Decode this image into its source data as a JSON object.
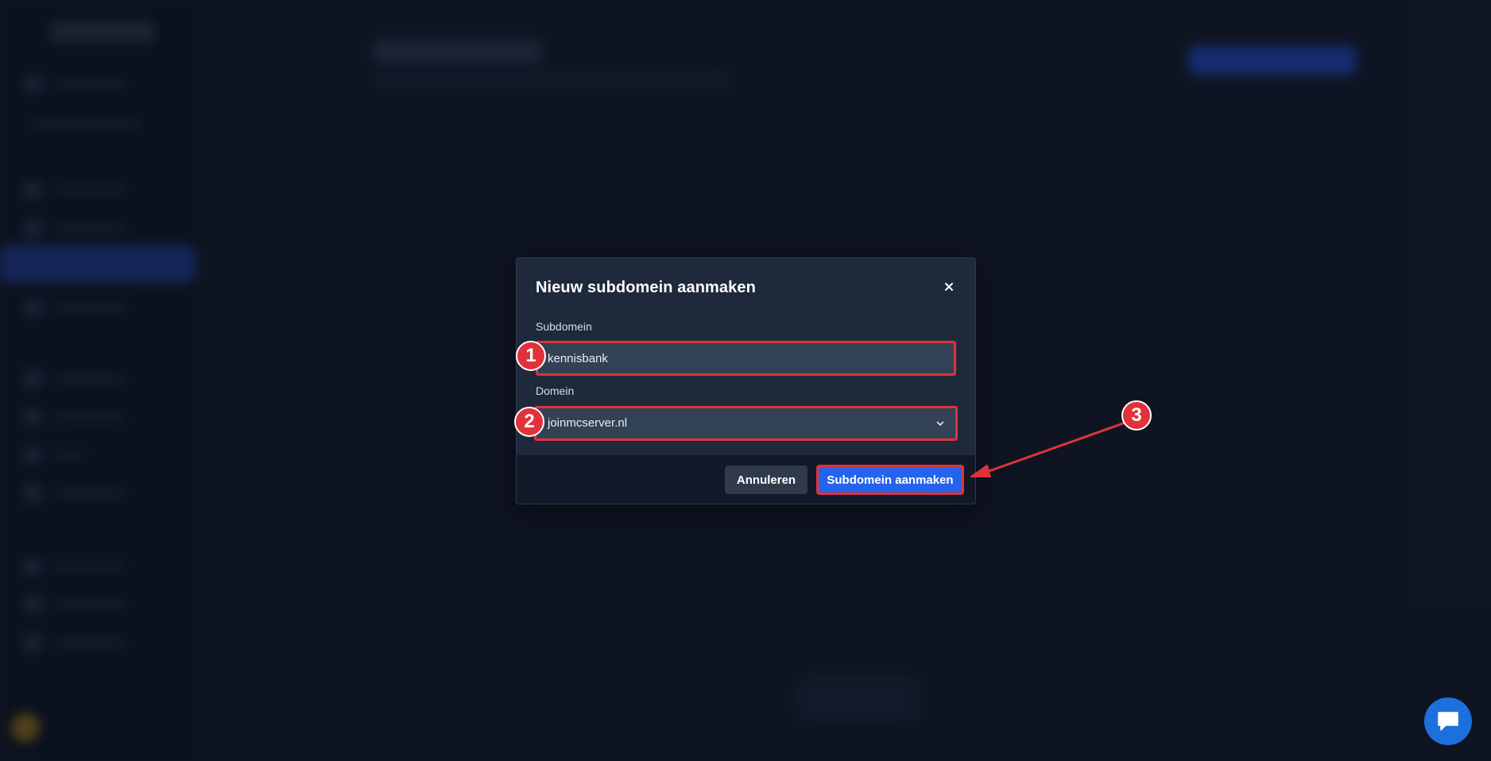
{
  "modal": {
    "title": "Nieuw subdomein aanmaken",
    "close_icon": "close-icon",
    "subdomain": {
      "label": "Subdomein",
      "value": "kennisbank"
    },
    "domain": {
      "label": "Domein",
      "selected": "joinmcserver.nl",
      "icon": "chevron-down-icon"
    },
    "buttons": {
      "cancel": "Annuleren",
      "create": "Subdomein aanmaken"
    }
  },
  "annotations": {
    "step1": "1",
    "step2": "2",
    "step3": "3",
    "color": "#e0323a"
  },
  "chat": {
    "icon": "chat-bubble-icon",
    "color": "#1d6fde"
  },
  "colors": {
    "background": "#131b2b",
    "modal": "#1e293b",
    "input": "#334155",
    "primary": "#2563eb",
    "footer": "#111827"
  }
}
